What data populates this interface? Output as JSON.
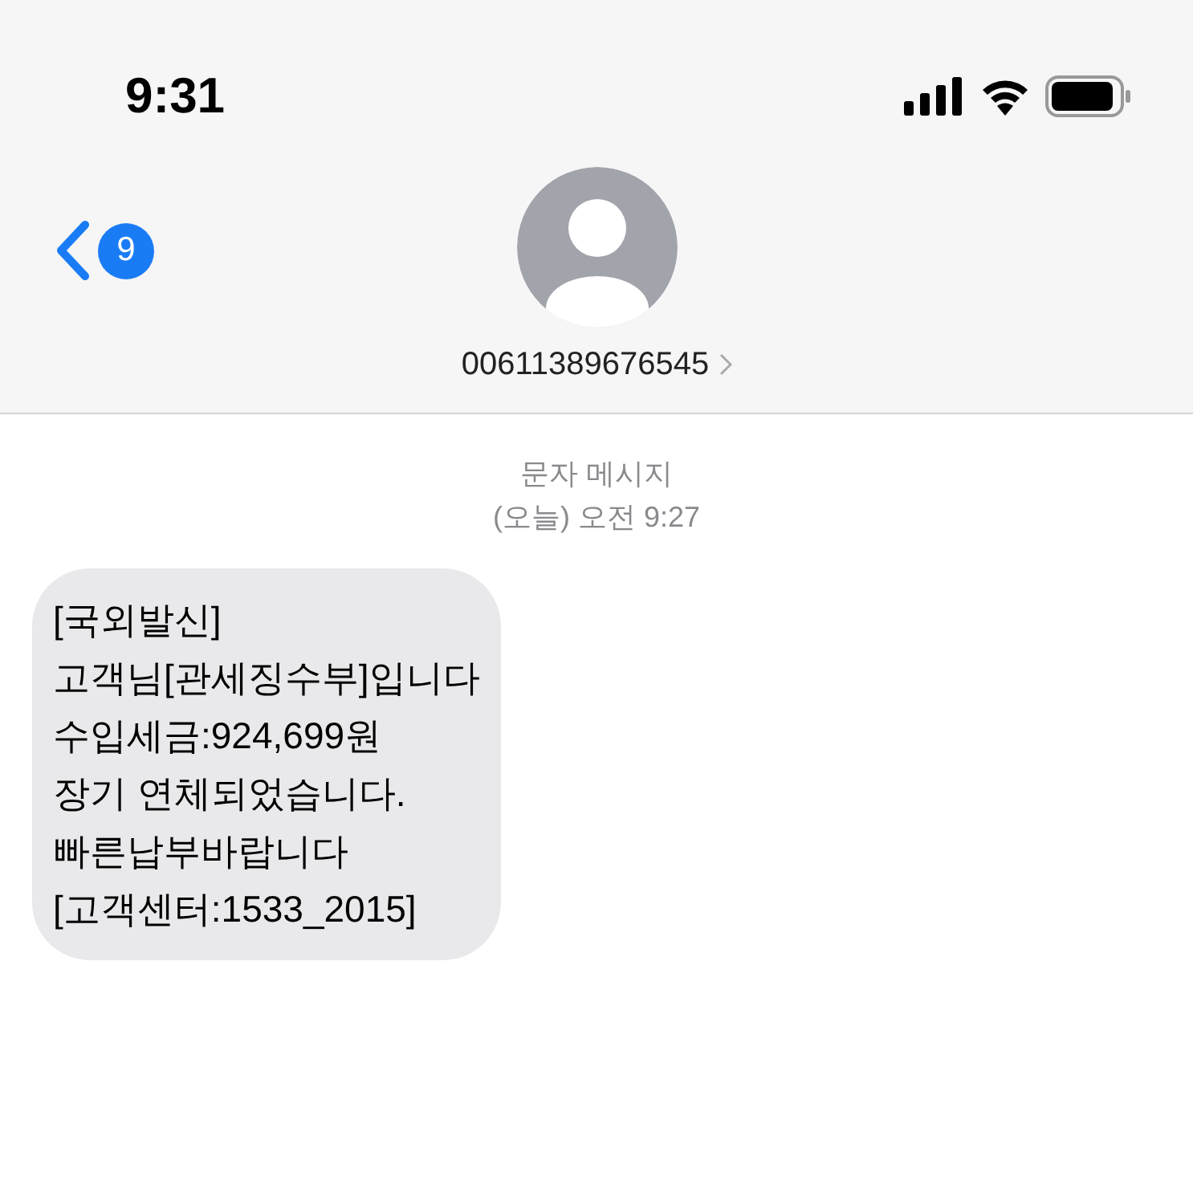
{
  "status_bar": {
    "time": "9:31"
  },
  "header": {
    "back_badge": "9",
    "contact": "00611389676545"
  },
  "thread": {
    "label": "문자 메시지",
    "timestamp": "(오늘) 오전 9:27"
  },
  "messages": [
    {
      "kind": "incoming",
      "lines": [
        "[국외발신]",
        "고객님[관세징수부]입니다",
        "수입세금:924,699원",
        "장기 연체되었습니다.",
        "빠른납부바랍니다",
        "[고객센터:1533_2015]"
      ]
    }
  ]
}
